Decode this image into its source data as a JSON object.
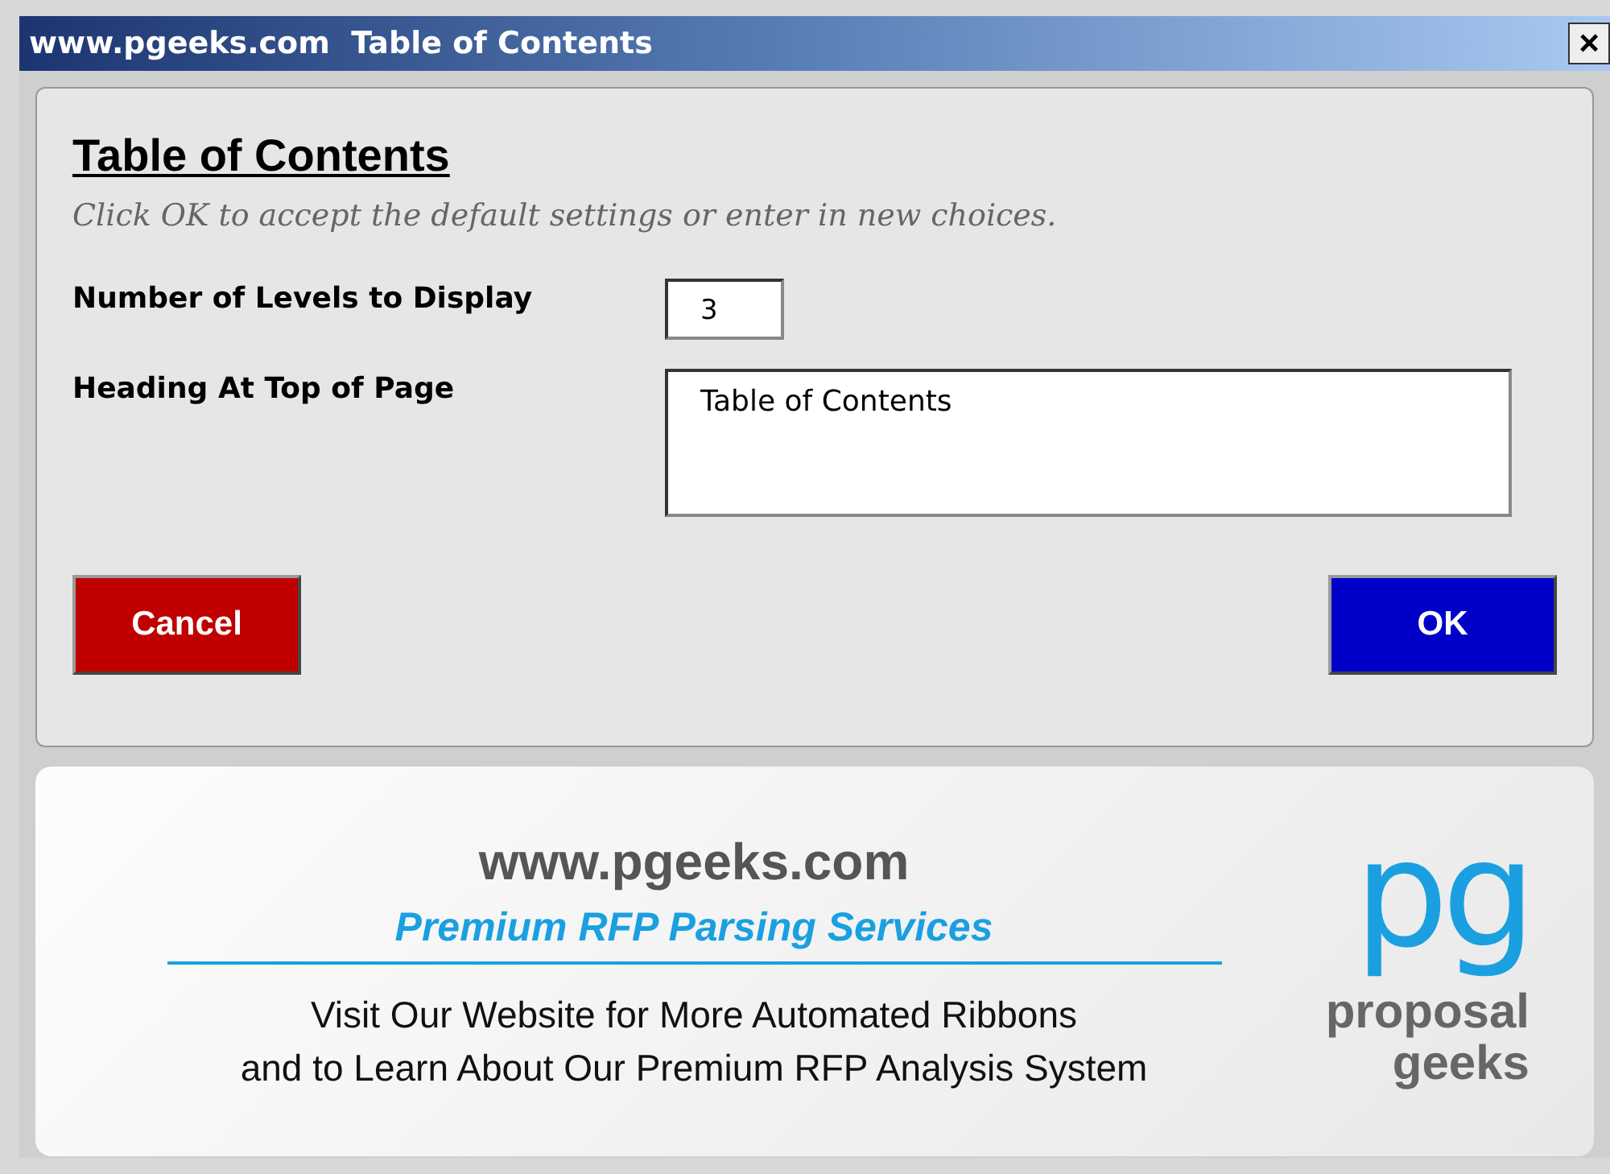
{
  "window": {
    "title": "www.pgeeks.com  Table of Contents",
    "close": "×"
  },
  "form": {
    "heading": "Table of Contents",
    "hint": "Click OK to accept the default settings or enter in new choices.",
    "fields": [
      {
        "label": "Number of Levels to Display",
        "value": "3",
        "kind": "short"
      },
      {
        "label": "Heading At Top of Page",
        "value": "Table of Contents",
        "kind": "multiline"
      }
    ],
    "buttons": [
      {
        "label": "Cancel",
        "kind": "cancel"
      },
      {
        "label": "OK",
        "kind": "ok"
      }
    ]
  },
  "banner": {
    "url": "www.pgeeks.com",
    "tagline": "Premium RFP Parsing Services",
    "lines": [
      "Visit Our Website for More Automated Ribbons",
      "and to Learn About Our Premium RFP Analysis System"
    ],
    "logo": {
      "mark": "pg",
      "words": [
        "proposal",
        "geeks"
      ]
    }
  }
}
